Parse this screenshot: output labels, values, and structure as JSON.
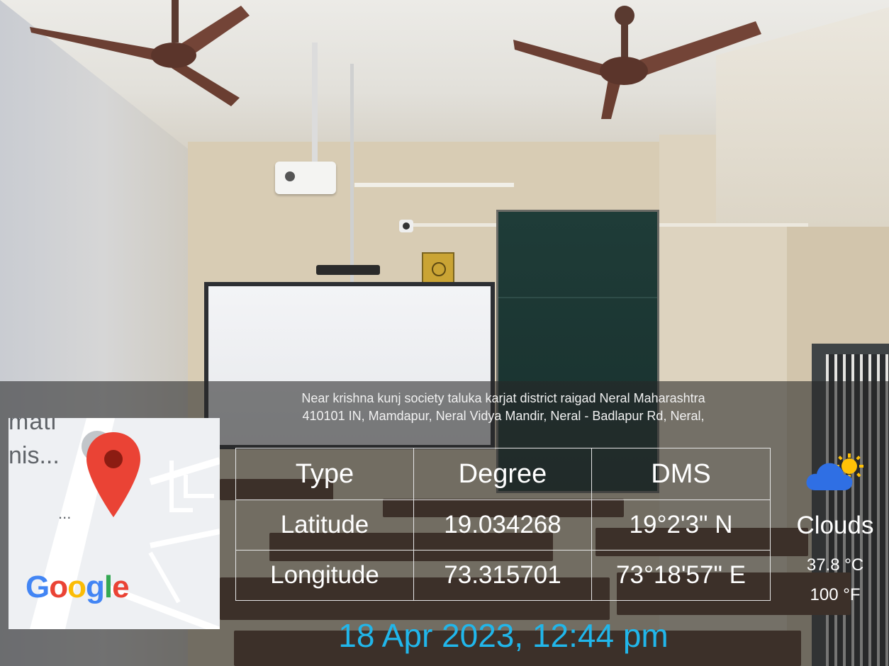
{
  "photo": {
    "address_lines": [
      "Near krishna kunj society taluka karjat district raigad Neral Maharashtra",
      "410101 IN, Mamdapur, Neral Vidya Mandir, Neral - Badlapur Rd, Neral,"
    ],
    "map": {
      "label_top": "mati",
      "label_place": "nis...",
      "dots": "...",
      "brand": [
        "G",
        "o",
        "o",
        "g",
        "l",
        "e"
      ],
      "brand_colors": [
        "#4285F4",
        "#EA4335",
        "#FBBC05",
        "#4285F4",
        "#34A853",
        "#EA4335"
      ],
      "pin_color": "#EA4335",
      "pin_icon": "map-pin-icon"
    },
    "coords_table": {
      "headers": [
        "Type",
        "Degree",
        "DMS"
      ],
      "rows": [
        [
          "Latitude",
          "19.034268",
          "19°2'3\" N"
        ],
        [
          "Longitude",
          "73.315701",
          "73°18'57\" E"
        ]
      ]
    },
    "weather": {
      "icon": "cloud-sun-icon",
      "condition": "Clouds",
      "temp_c": "37.8 °C",
      "temp_f": "100 °F"
    },
    "datetime": "18 Apr 2023, 12:44 pm",
    "datetime_color": "#21B6EA"
  }
}
